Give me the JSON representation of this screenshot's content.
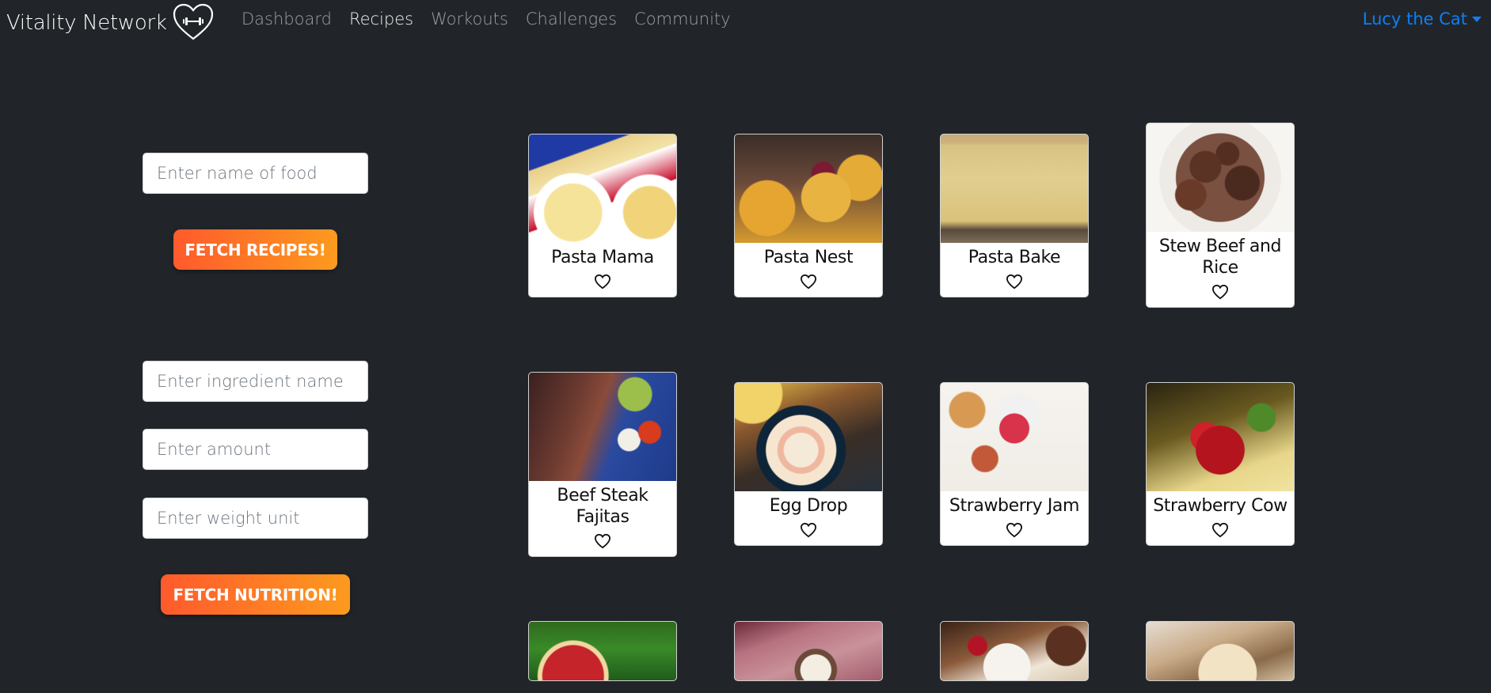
{
  "navbar": {
    "brand": "Vitality Network",
    "links": [
      {
        "label": "Dashboard",
        "active": false
      },
      {
        "label": "Recipes",
        "active": true
      },
      {
        "label": "Workouts",
        "active": false
      },
      {
        "label": "Challenges",
        "active": false
      },
      {
        "label": "Community",
        "active": false
      }
    ],
    "user": "Lucy the Cat"
  },
  "recipe_search": {
    "food_placeholder": "Enter name of food",
    "button_label": "FETCH RECIPES!"
  },
  "nutrition_search": {
    "ingredient_placeholder": "Enter ingredient name",
    "amount_placeholder": "Enter amount",
    "unit_placeholder": "Enter weight unit",
    "button_label": "FETCH NUTRITION!"
  },
  "recipes": [
    {
      "title": "Pasta Mama"
    },
    {
      "title": "Pasta Nest"
    },
    {
      "title": "Pasta Bake"
    },
    {
      "title": "Stew Beef and Rice"
    },
    {
      "title": "Beef Steak Fajitas"
    },
    {
      "title": "Egg Drop"
    },
    {
      "title": "Strawberry Jam"
    },
    {
      "title": "Strawberry Cow"
    }
  ],
  "colors": {
    "background": "#212529",
    "accent_link": "#0d7ff5",
    "button_gradient_start": "#ff5a2c",
    "button_gradient_end": "#fd9a1f"
  },
  "icons": {
    "brand_logo": "heart-dumbbell-icon",
    "favorite": "heart-outline-icon",
    "user_dropdown": "caret-down-icon"
  }
}
